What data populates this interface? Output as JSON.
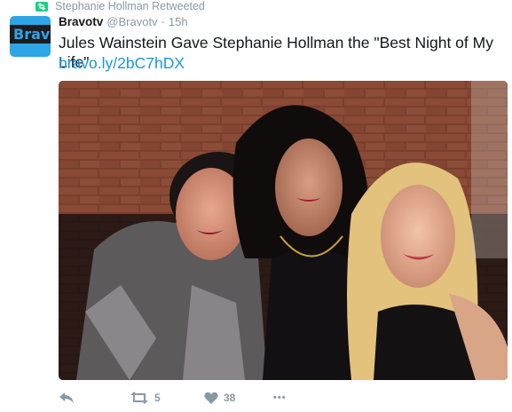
{
  "retweet_context": {
    "text": "Stephanie Hollman Retweeted",
    "icon": "retweet-icon"
  },
  "author": {
    "name": "Bravotv",
    "handle": "@Bravotv",
    "time": "15h",
    "avatar_text": "Bravo"
  },
  "tweet": {
    "text": "Jules Wainstein Gave Stephanie Hollman the \"Best Night of My Life\"",
    "link": "bravo.ly/2bC7hDX"
  },
  "media": {
    "description_icon": "photo"
  },
  "actions": {
    "reply": {
      "icon": "reply-icon",
      "count": ""
    },
    "retweet": {
      "icon": "retweet-icon",
      "count": "5"
    },
    "like": {
      "icon": "heart-icon",
      "count": "38"
    },
    "more": {
      "icon": "more-icon",
      "label": "•••"
    }
  },
  "colors": {
    "link": "#1b95e0",
    "muted": "#8899a6",
    "retweet_green": "#19cf86",
    "bravo_blue": "#2ea5e6"
  }
}
